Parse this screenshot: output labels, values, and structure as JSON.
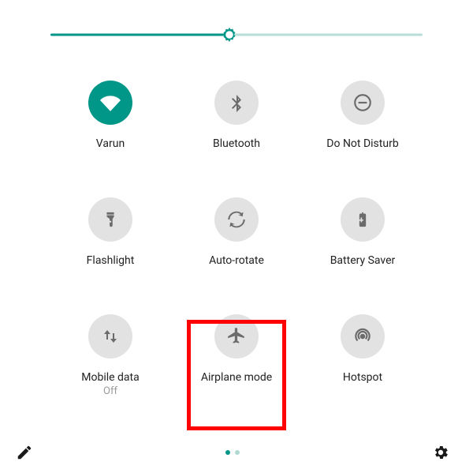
{
  "brightness": {
    "percent": 48
  },
  "tiles": {
    "wifi": {
      "label": "Varun",
      "active": true
    },
    "bluetooth": {
      "label": "Bluetooth",
      "active": false
    },
    "dnd": {
      "label": "Do Not Disturb",
      "active": false
    },
    "flashlight": {
      "label": "Flashlight",
      "active": false
    },
    "autorotate": {
      "label": "Auto-rotate",
      "active": false
    },
    "battery": {
      "label": "Battery Saver",
      "active": false
    },
    "mobiledata": {
      "label": "Mobile data",
      "sub": "Off",
      "active": false
    },
    "airplane": {
      "label": "Airplane mode",
      "active": false
    },
    "hotspot": {
      "label": "Hotspot",
      "active": false
    }
  },
  "highlight": "airplane",
  "pager": {
    "pages": 2,
    "current": 0
  },
  "colors": {
    "accent": "#009688",
    "iconInactive": "#6b6b6b",
    "iconActive": "#ffffff",
    "highlight": "#ff0000"
  }
}
